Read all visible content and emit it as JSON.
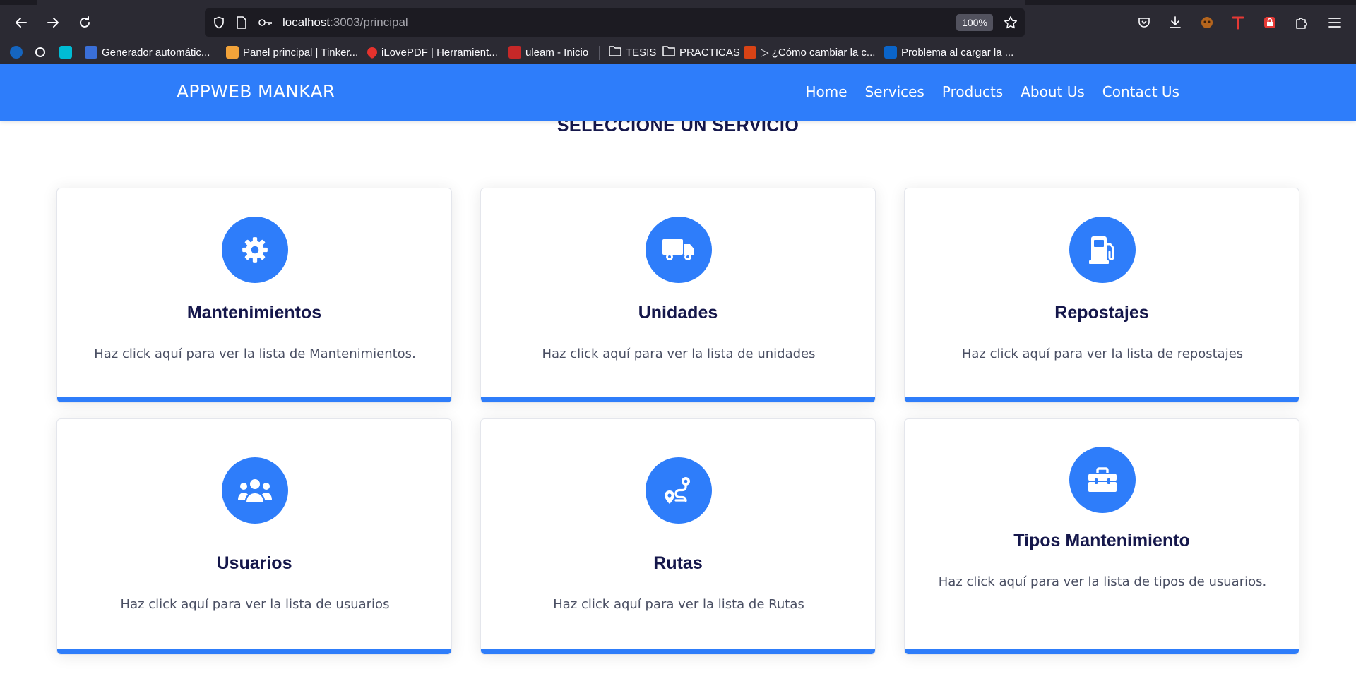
{
  "browser": {
    "url_host": "localhost",
    "url_path": ":3003/principal",
    "zoom": "100%",
    "bookmarks": [
      {
        "label": "Generador automátic...",
        "color": "#3a6fd8"
      },
      {
        "label": "Panel principal | Tinker...",
        "color": "#f2a33a"
      },
      {
        "label": "iLovePDF | Herramient...",
        "color": "#e5322d"
      },
      {
        "label": "uleam - Inicio",
        "color": "#c62828"
      },
      {
        "label": "TESIS",
        "color": "folder"
      },
      {
        "label": "PRACTICAS",
        "color": "folder"
      },
      {
        "label": "▷ ¿Cómo cambiar la c...",
        "color": "#d84315"
      },
      {
        "label": "Problema al cargar la ...",
        "color": "#0a64c8"
      }
    ]
  },
  "header": {
    "brand": "APPWEB MANKAR",
    "menu": [
      "Home",
      "Services",
      "Products",
      "About Us",
      "Contact Us"
    ]
  },
  "main": {
    "title": "SELECCIONE UN SERVICIO",
    "cards": [
      {
        "icon": "gear-icon",
        "title": "Mantenimientos",
        "desc": "Haz click aquí para ver la lista de Mantenimientos."
      },
      {
        "icon": "truck-icon",
        "title": "Unidades",
        "desc": "Haz click aquí para ver la lista de unidades"
      },
      {
        "icon": "gas-pump-icon",
        "title": "Repostajes",
        "desc": "Haz click aquí para ver la lista de repostajes"
      },
      {
        "icon": "users-icon",
        "title": "Usuarios",
        "desc": "Haz click aquí para ver la lista de usuarios"
      },
      {
        "icon": "route-icon",
        "title": "Rutas",
        "desc": "Haz click aquí para ver la lista de Rutas"
      },
      {
        "icon": "toolbox-icon",
        "title": "Tipos Mantenimiento",
        "desc": "Haz click aquí para ver la lista de tipos de usuarios."
      }
    ]
  },
  "colors": {
    "accent": "#2e7dfa",
    "heading": "#15174b",
    "text": "#4a4f63"
  }
}
